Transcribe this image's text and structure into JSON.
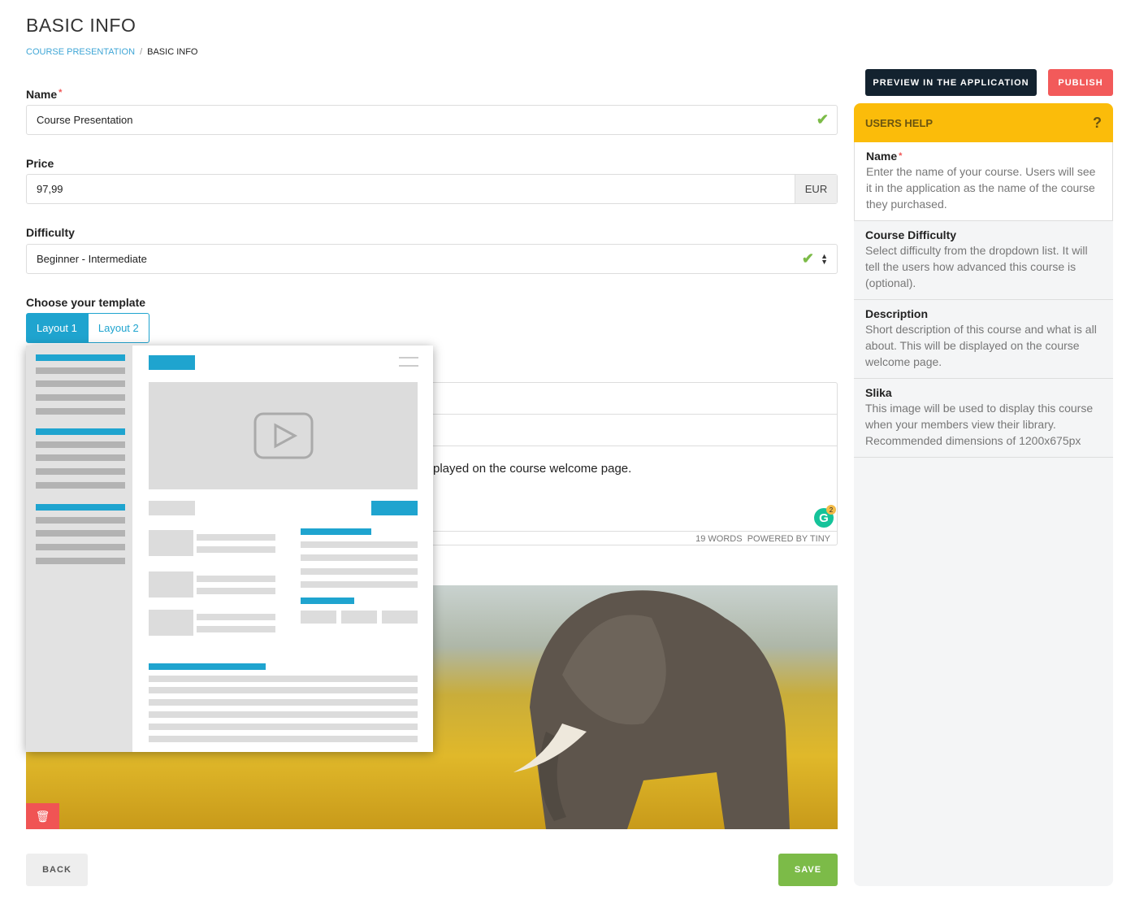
{
  "page": {
    "title": "BASIC INFO",
    "breadcrumb": [
      "COURSE PRESENTATION",
      "BASIC INFO"
    ]
  },
  "form": {
    "name": {
      "label": "Name",
      "value": "Course Presentation"
    },
    "price": {
      "label": "Price",
      "value": "97,99",
      "currency": "EUR"
    },
    "difficulty": {
      "label": "Difficulty",
      "value": "Beginner - Intermediate"
    },
    "template": {
      "label": "Choose your template",
      "tabs": [
        "Layout 1",
        "Layout 2"
      ],
      "selected": "Layout 1"
    },
    "description": {
      "text": "played on the course welcome page.",
      "word_count": "19 WORDS",
      "powered": "POWERED BY TINY",
      "grammarly_badge": "2"
    }
  },
  "actions": {
    "preview": "PREVIEW IN THE APPLICATION",
    "publish": "PUBLISH",
    "back": "BACK",
    "save": "SAVE"
  },
  "help": {
    "title": "USERS HELP",
    "icon": "?",
    "sections": [
      {
        "title": "Name",
        "required": true,
        "text": "Enter the name of your course. Users will see it in the application as the name of the course they purchased."
      },
      {
        "title": "Course Difficulty",
        "text": "Select difficulty from the dropdown list. It will tell the users how advanced this course is (optional)."
      },
      {
        "title": "Description",
        "text": "Short description of this course and what is all about. This will be displayed on the course welcome page."
      },
      {
        "title": "Slika",
        "text": "This image will be used to display this course when your members view their library. Recommended dimensions of 1200x675px"
      }
    ]
  },
  "colors": {
    "accent": "#1fa4cf",
    "publish": "#f05454",
    "preview": "#13222f",
    "save": "#7cbb48",
    "help_header": "#fbbc0a"
  }
}
